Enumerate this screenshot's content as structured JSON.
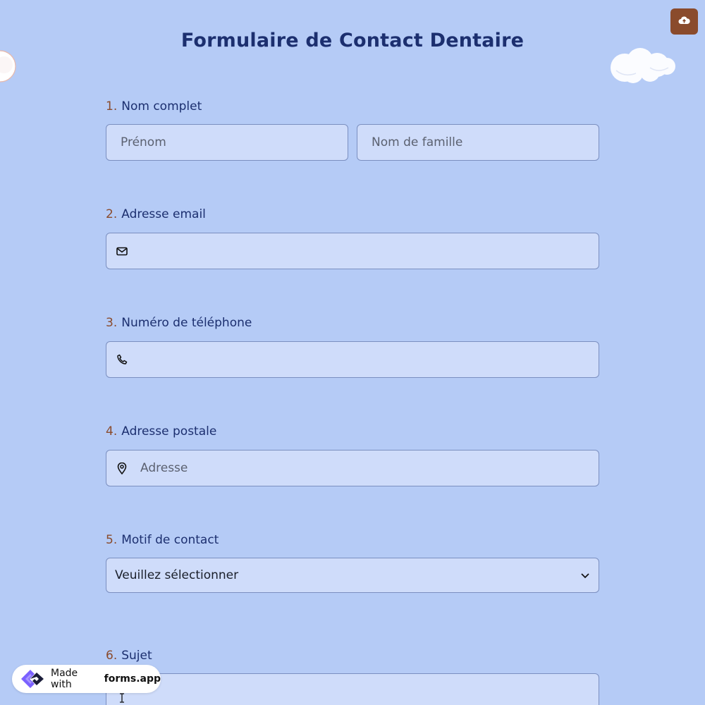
{
  "form": {
    "title": "Formulaire de Contact Dentaire"
  },
  "toolbar": {
    "upload_icon": "cloud-upload-icon"
  },
  "questions": [
    {
      "number": "1.",
      "label": "Nom complet",
      "fields": [
        {
          "placeholder": "Prénom"
        },
        {
          "placeholder": "Nom de famille"
        }
      ]
    },
    {
      "number": "2.",
      "label": "Adresse email",
      "icon": "mail-icon",
      "value": ""
    },
    {
      "number": "3.",
      "label": "Numéro de téléphone",
      "icon": "phone-icon",
      "value": ""
    },
    {
      "number": "4.",
      "label": "Adresse postale",
      "icon": "map-pin-icon",
      "placeholder": "Adresse"
    },
    {
      "number": "5.",
      "label": "Motif de contact",
      "selected": "Veuillez sélectionner"
    },
    {
      "number": "6.",
      "label": "Sujet",
      "value": ""
    }
  ],
  "badge": {
    "prefix": "Made with",
    "brand": "forms.app"
  },
  "colors": {
    "background": "#b5cbf6",
    "field": "#cfdcfa",
    "accent": "#8a4b2c",
    "title": "#1c2f6f"
  }
}
